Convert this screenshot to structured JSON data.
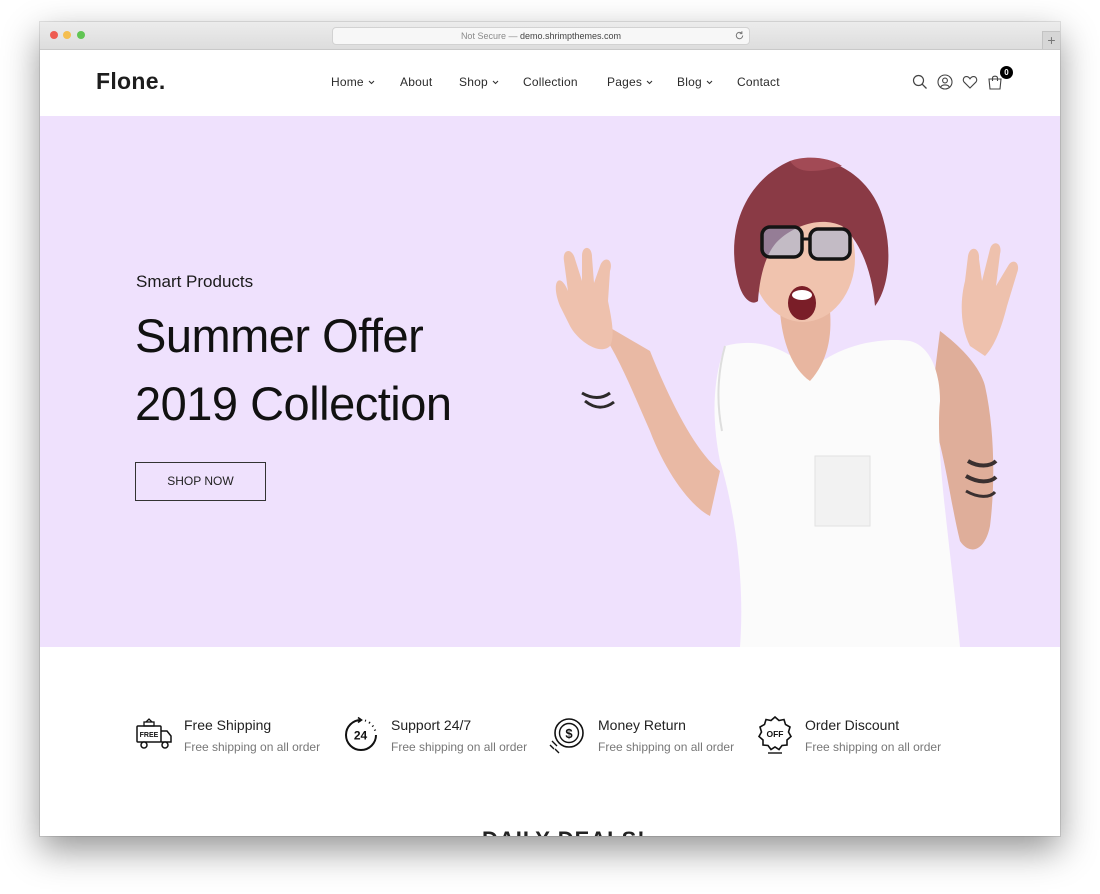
{
  "browser": {
    "security_label": "Not Secure",
    "separator": "—",
    "domain": "demo.shrimpthemes.com",
    "new_tab_symbol": "+"
  },
  "header": {
    "logo": "Flone.",
    "nav": [
      {
        "label": "Home",
        "has_dropdown": true
      },
      {
        "label": "About",
        "has_dropdown": false
      },
      {
        "label": "Shop",
        "has_dropdown": true
      },
      {
        "label": "Collection",
        "has_dropdown": false
      },
      {
        "label": "Pages",
        "has_dropdown": true
      },
      {
        "label": "Blog",
        "has_dropdown": true
      },
      {
        "label": "Contact",
        "has_dropdown": false
      }
    ],
    "icons": [
      "search-icon",
      "account-icon",
      "wishlist-icon",
      "cart-icon"
    ],
    "cart_count": "0"
  },
  "hero": {
    "subtitle": "Smart Products",
    "title_line1": "Summer Offer",
    "title_line2": "2019 Collection",
    "button": "SHOP NOW",
    "background": "#efe1fd"
  },
  "features": [
    {
      "icon": "free-shipping-truck-icon",
      "badge": "FREE",
      "title": "Free Shipping",
      "desc": "Free shipping on all order"
    },
    {
      "icon": "support-24-icon",
      "badge": "24",
      "title": "Support 24/7",
      "desc": "Free shipping on all order"
    },
    {
      "icon": "money-return-icon",
      "badge": "$",
      "title": "Money Return",
      "desc": "Free shipping on all order"
    },
    {
      "icon": "discount-badge-icon",
      "badge": "OFF",
      "title": "Order Discount",
      "desc": "Free shipping on all order"
    }
  ],
  "section": {
    "daily_deals": "DAILY DEALS!"
  }
}
